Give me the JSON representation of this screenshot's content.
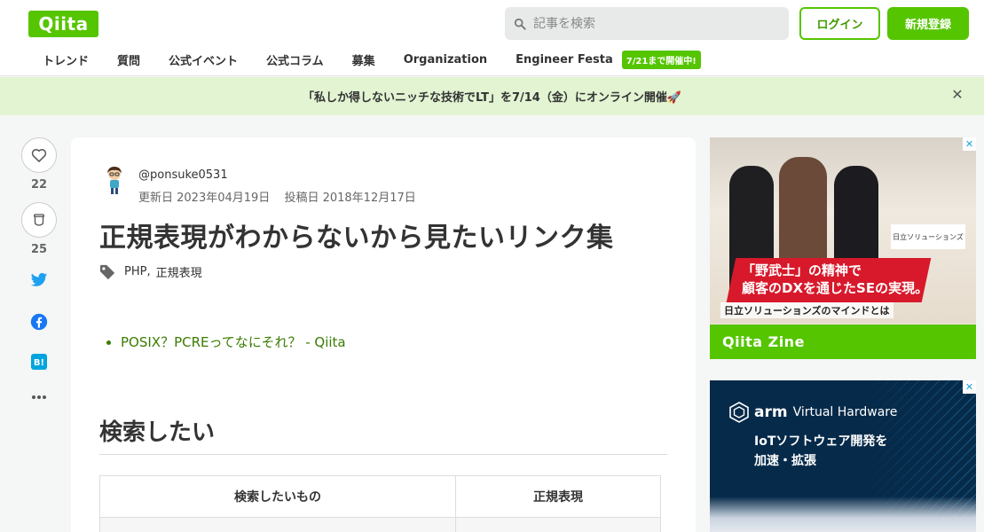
{
  "header": {
    "logo_text": "Qiita",
    "search_placeholder": "記事を検索",
    "login_label": "ログイン",
    "signup_label": "新規登録"
  },
  "nav": {
    "items": [
      "トレンド",
      "質問",
      "公式イベント",
      "公式コラム",
      "募集",
      "Organization",
      "Engineer Festa"
    ],
    "badge": "7/21まで開催中!"
  },
  "banner": {
    "text": "「私しか得しないニッチな技術でLT」を7/14（金）にオンライン開催🚀",
    "close": "✕"
  },
  "side_actions": {
    "like_count": "22",
    "stock_count": "25"
  },
  "article": {
    "author": "@ponsuke0531",
    "updated": "更新日 2023年04月19日",
    "posted": "投稿日 2018年12月17日",
    "title": "正規表現がわからないから見たいリンク集",
    "tags": [
      "PHP",
      "正規表現"
    ],
    "links": [
      "POSIX？PCREってなにそれ？ - Qiita"
    ],
    "section_heading": "検索したい",
    "table": {
      "headers": [
        "検索したいもの",
        "正規表現"
      ]
    }
  },
  "ads": {
    "ad1": {
      "copy_line1": "「野武士」の精神で",
      "copy_line2": "顧客のDXを通じたSEの実現。",
      "copy_sub": "日立ソリューションズのマインドとは",
      "sign": "日立ソリューションズ",
      "footer": "Qiita Zine",
      "close": "✕"
    },
    "ad2": {
      "brand": "arm",
      "product": "Virtual Hardware",
      "copy_line1": "IoTソフトウェア開発を",
      "copy_line2": "加速・拡張",
      "close": "✕"
    }
  },
  "colors": {
    "brand_green": "#55c500",
    "banner_bg": "#e2f4d2",
    "link_green": "#3a7c00"
  }
}
